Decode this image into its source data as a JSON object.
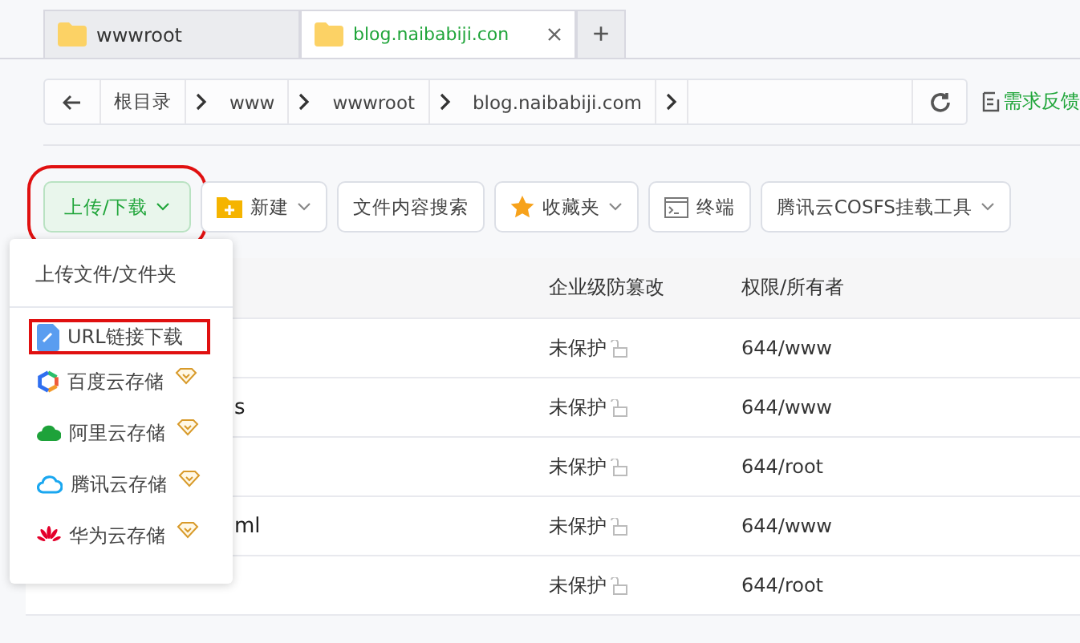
{
  "tabs": [
    {
      "label": "wwwroot",
      "selected": false
    },
    {
      "label": "blog.naibabiji.con",
      "selected": true
    }
  ],
  "new_tab": "+",
  "breadcrumb": [
    "根目录",
    "www",
    "wwwroot",
    "blog.naibabiji.com"
  ],
  "feedback": "需求反馈",
  "toolbar": [
    {
      "label": "上传/下载",
      "kind": "primary",
      "caret": true,
      "highlighted": true
    },
    {
      "label": "新建",
      "kind": "plain",
      "caret": true,
      "highlighted": false
    },
    {
      "label": "文件内容搜索",
      "kind": "plain",
      "caret": false,
      "highlighted": false
    },
    {
      "label": "收藏夹",
      "kind": "plain",
      "caret": true,
      "highlighted": false
    },
    {
      "label": "终端",
      "kind": "plain",
      "caret": false,
      "highlighted": false
    },
    {
      "label": "腾讯云COSFS挂载工具",
      "kind": "plain",
      "caret": true,
      "highlighted": false
    }
  ],
  "table": {
    "columns": [
      "企业级防篡改",
      "权限/所有者"
    ],
    "rows": [
      {
        "name": "",
        "protection": "未保护",
        "perm": "644/www"
      },
      {
        "name": "s",
        "protection": "未保护",
        "perm": "644/www"
      },
      {
        "name": "",
        "protection": "未保护",
        "perm": "644/root"
      },
      {
        "name": "ml",
        "protection": "未保护",
        "perm": "644/www"
      },
      {
        "name": "",
        "protection": "未保护",
        "perm": "644/root"
      }
    ]
  },
  "menu": {
    "header": "上传文件/文件夹",
    "items": [
      {
        "label": "URL链接下载",
        "vip": false,
        "highlighted": true
      },
      {
        "label": "百度云存储",
        "vip": true,
        "highlighted": false
      },
      {
        "label": "阿里云存储",
        "vip": true,
        "highlighted": false
      },
      {
        "label": "腾讯云存储",
        "vip": true,
        "highlighted": false
      },
      {
        "label": "华为云存储",
        "vip": true,
        "highlighted": false
      }
    ]
  }
}
